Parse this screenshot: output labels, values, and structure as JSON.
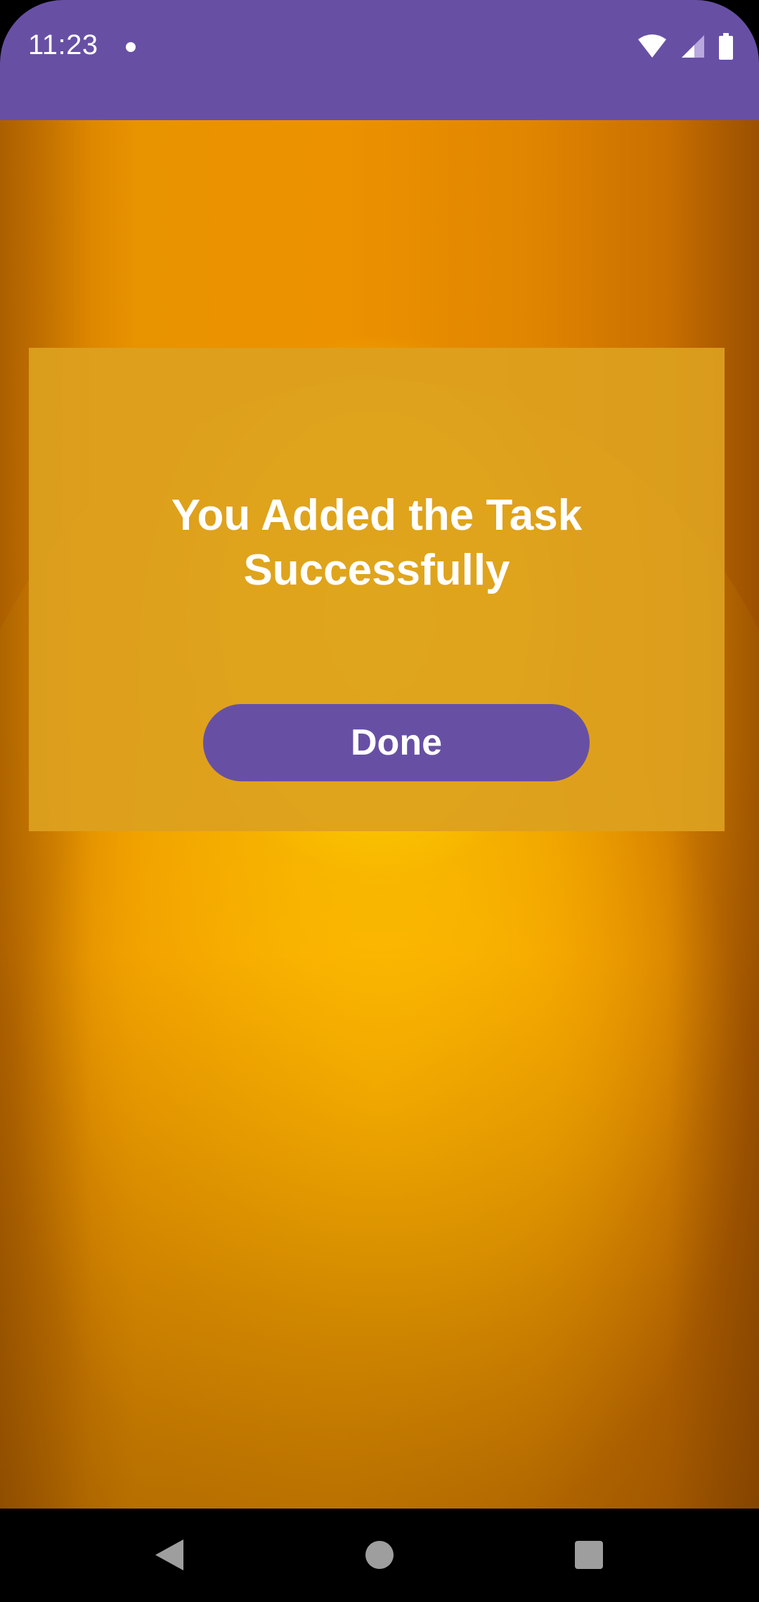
{
  "status_bar": {
    "time": "11:23",
    "background_color": "#6750A4",
    "icons": [
      "notification-dot-icon",
      "wifi-icon",
      "cell-signal-icon",
      "battery-icon"
    ]
  },
  "dialog": {
    "title_line1": "You Added the Task",
    "title_line2": "Successfully",
    "done_label": "Done",
    "button_color": "#6750A4"
  },
  "nav_bar": {
    "icons": [
      "back-icon",
      "home-icon",
      "recents-icon"
    ]
  }
}
